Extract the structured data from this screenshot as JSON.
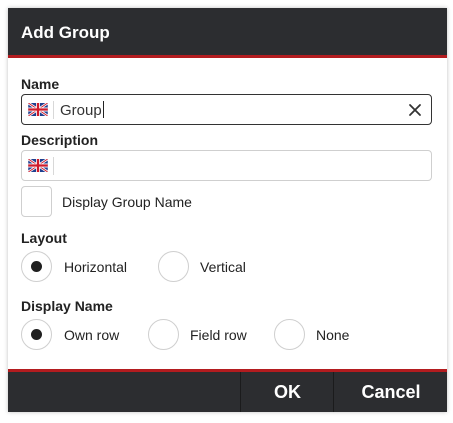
{
  "dialog": {
    "title": "Add Group",
    "accent_color": "#b31c1f",
    "bar_color": "#2c2d30"
  },
  "name_field": {
    "label": "Name",
    "value": "Group",
    "flag_icon": "uk-flag-icon",
    "clear_icon": "close-icon"
  },
  "description_field": {
    "label": "Description",
    "value": "",
    "flag_icon": "uk-flag-icon"
  },
  "display_group_name": {
    "label": "Display Group Name",
    "checked": false
  },
  "layout": {
    "label": "Layout",
    "options": [
      {
        "label": "Horizontal",
        "selected": true
      },
      {
        "label": "Vertical",
        "selected": false
      }
    ]
  },
  "display_name": {
    "label": "Display Name",
    "options": [
      {
        "label": "Own row",
        "selected": true
      },
      {
        "label": "Field row",
        "selected": false
      },
      {
        "label": "None",
        "selected": false
      }
    ]
  },
  "footer": {
    "ok_label": "OK",
    "cancel_label": "Cancel"
  }
}
